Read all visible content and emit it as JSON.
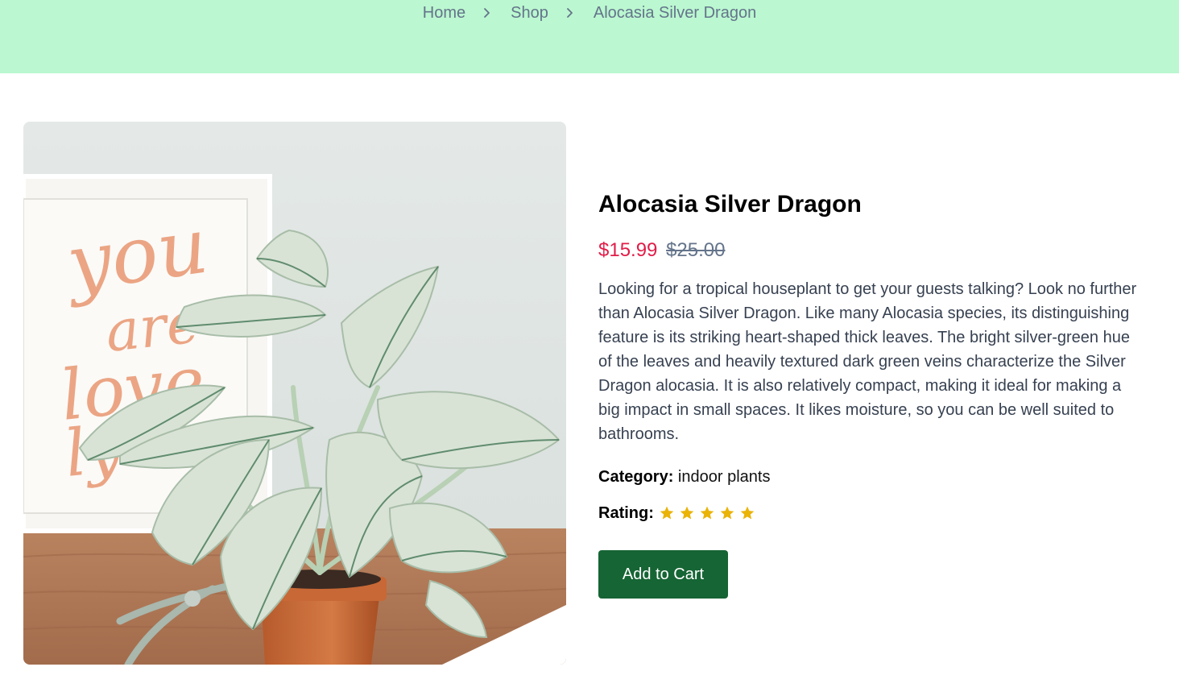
{
  "breadcrumb": {
    "items": [
      "Home",
      "Shop",
      "Alocasia Silver Dragon"
    ]
  },
  "product": {
    "title": "Alocasia Silver Dragon",
    "price_sale": "$15.99",
    "price_original": "$25.00",
    "description": "Looking for a tropical houseplant to get your guests talking? Look no further than Alocasia Silver Dragon. Like many Alocasia species, its distinguishing feature is its striking heart-shaped thick leaves. The bright silver-green hue of the leaves and heavily textured dark green veins characterize the Silver Dragon alocasia. It is also relatively compact, making it ideal for making a big impact in small spaces. It likes moisture, so you can be well suited to bathrooms.",
    "category_label": "Category:",
    "category_value": "indoor plants",
    "rating_label": "Rating:",
    "rating_value": 5,
    "rating_max": 5,
    "add_to_cart_label": "Add to Cart"
  },
  "colors": {
    "banner": "#bbf7d0",
    "sale_price": "#e11d48",
    "button": "#166534",
    "star": "#eab308"
  },
  "icons": {
    "breadcrumb_separator": "chevron-right-icon",
    "rating": "star-icon"
  }
}
